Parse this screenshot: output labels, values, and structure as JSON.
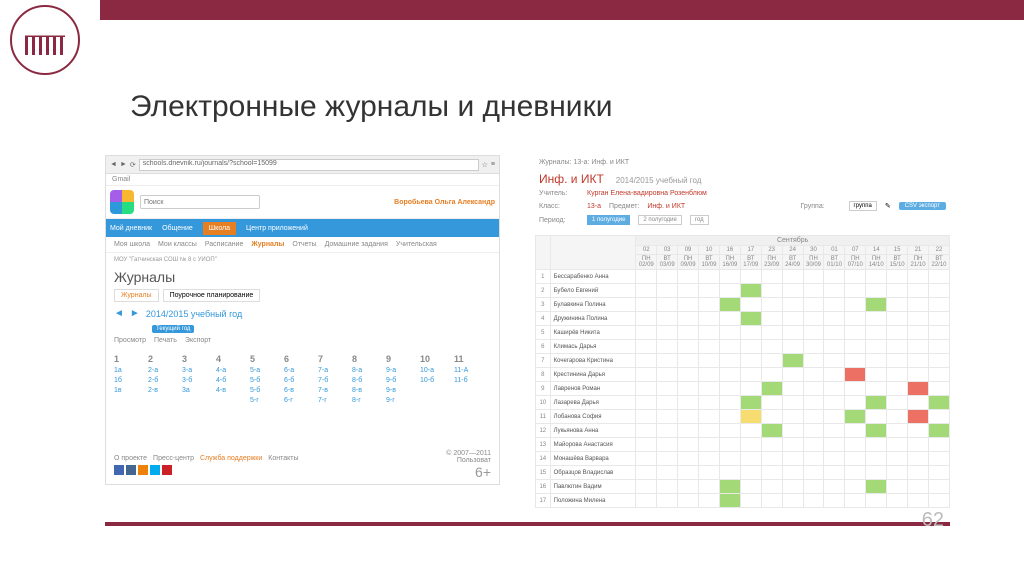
{
  "slide": {
    "title": "Электронные журналы и дневники",
    "page_num": "62"
  },
  "left": {
    "url": "schools.dnevnik.ru/journals/?school=15099",
    "gmail_tab": "Gmail",
    "search_placeholder": "Поиск",
    "user": "Воробьева Ольга Александр",
    "main_nav": [
      "Мой дневник",
      "Общение",
      "Школа",
      "Центр приложений"
    ],
    "main_nav_active": 2,
    "sub_nav": [
      "Моя школа",
      "Мои классы",
      "Расписание",
      "Журналы",
      "Отчеты",
      "Домашние задания",
      "Учительская"
    ],
    "sub_nav_active": 3,
    "school": "МОУ \"Гатчинская СОШ № 8 с УИОП\"",
    "page_title": "Журналы",
    "tabs": [
      "Журналы",
      "Поурочное планирование"
    ],
    "year": "2014/2015 учебный год",
    "year_badge": "Текущий год",
    "actions": [
      "Просмотр",
      "Печать",
      "Экспорт"
    ],
    "grade_headers": [
      "1",
      "2",
      "3",
      "4",
      "5",
      "6",
      "7",
      "8",
      "9",
      "10",
      "11"
    ],
    "grade_rows": [
      [
        "1а",
        "2-а",
        "3-а",
        "4-а",
        "5-а",
        "6-а",
        "7-а",
        "8-а",
        "9-а",
        "10-а",
        "11-А"
      ],
      [
        "1б",
        "2-б",
        "3-б",
        "4-б",
        "5-б",
        "6-б",
        "7-б",
        "8-б",
        "9-б",
        "10-б",
        "11-б"
      ],
      [
        "1в",
        "2-в",
        "3а",
        "4-в",
        "5-б",
        "6-в",
        "7-в",
        "8-в",
        "9-в",
        "",
        ""
      ],
      [
        "",
        "",
        "",
        "",
        "5-г",
        "6-г",
        "7-г",
        "8-г",
        "9-г",
        "",
        ""
      ]
    ],
    "footer_links": [
      "О проекте",
      "Пресс-центр",
      "Служба поддержки",
      "Контакты"
    ],
    "footer_highlight": 2,
    "copyright": "© 2007—2011",
    "userlink": "Пользоват",
    "age": "6+"
  },
  "right": {
    "breadcrumb": "Журналы: 13-а: Инф. и ИКТ",
    "subject": "Инф. и ИКТ",
    "year": "2014/2015 учебный год",
    "teacher_label": "Учитель:",
    "teacher": "Курган Елена-вадировна Розенблюм",
    "class_label": "Класс:",
    "class": "13-а",
    "subject_label": "Предмет:",
    "subject_val": "Инф. и ИКТ",
    "group_label": "Группа:",
    "group": "группа",
    "period_label": "Период:",
    "periods": [
      "1 полугодие",
      "2 полугодие",
      "год"
    ],
    "csv": "CSV экспорт",
    "month": "Сентябрь",
    "dates": [
      {
        "d": "02",
        "w": "ПН",
        "s": "02/09"
      },
      {
        "d": "03",
        "w": "ВТ",
        "s": "03/09"
      },
      {
        "d": "09",
        "w": "ПН",
        "s": "09/09"
      },
      {
        "d": "10",
        "w": "ВТ",
        "s": "10/09"
      },
      {
        "d": "16",
        "w": "ПН",
        "s": "16/09"
      },
      {
        "d": "17",
        "w": "ВТ",
        "s": "17/09"
      },
      {
        "d": "23",
        "w": "ПН",
        "s": "23/09"
      },
      {
        "d": "24",
        "w": "ВТ",
        "s": "24/09"
      },
      {
        "d": "30",
        "w": "ПН",
        "s": "30/09"
      },
      {
        "d": "01",
        "w": "ВТ",
        "s": "01/10"
      },
      {
        "d": "07",
        "w": "ПН",
        "s": "07/10"
      },
      {
        "d": "14",
        "w": "ПН",
        "s": "14/10"
      },
      {
        "d": "15",
        "w": "ВТ",
        "s": "15/10"
      },
      {
        "d": "21",
        "w": "ПН",
        "s": "21/10"
      },
      {
        "d": "22",
        "w": "ВТ",
        "s": "22/10"
      }
    ],
    "students": [
      {
        "n": "1",
        "name": "Бессарабенко Анна",
        "g": {}
      },
      {
        "n": "2",
        "name": "Бубело Евгений",
        "g": {
          "5": "g"
        }
      },
      {
        "n": "3",
        "name": "Булавкина Полина",
        "g": {
          "4": "g",
          "11": "g"
        }
      },
      {
        "n": "4",
        "name": "Дружинина Полина",
        "g": {
          "5": "g"
        }
      },
      {
        "n": "5",
        "name": "Каширёв Никита",
        "g": {}
      },
      {
        "n": "6",
        "name": "Климась Дарья",
        "g": {}
      },
      {
        "n": "7",
        "name": "Кочегарова Кристина",
        "g": {
          "7": "g"
        }
      },
      {
        "n": "8",
        "name": "Крестинина Дарья",
        "g": {
          "10": "r"
        }
      },
      {
        "n": "9",
        "name": "Лавренов Роман",
        "g": {
          "6": "g",
          "13": "r"
        }
      },
      {
        "n": "10",
        "name": "Лазарева Дарья",
        "g": {
          "5": "g",
          "11": "g",
          "14": "g"
        }
      },
      {
        "n": "11",
        "name": "Лобанова София",
        "g": {
          "5": "y",
          "10": "g",
          "13": "r"
        }
      },
      {
        "n": "12",
        "name": "Лукьянова Анна",
        "g": {
          "6": "g",
          "11": "g",
          "14": "g"
        }
      },
      {
        "n": "13",
        "name": "Майорова Анастасия",
        "g": {}
      },
      {
        "n": "14",
        "name": "Монашёва Варвара",
        "g": {}
      },
      {
        "n": "15",
        "name": "Образцов Владислав",
        "g": {}
      },
      {
        "n": "16",
        "name": "Павлютин Вадим",
        "g": {
          "4": "g",
          "11": "g"
        }
      },
      {
        "n": "17",
        "name": "Положина Милена",
        "g": {
          "4": "g"
        }
      }
    ]
  }
}
